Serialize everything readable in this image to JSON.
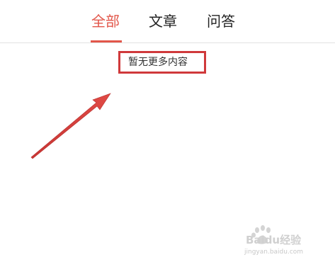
{
  "tabs": [
    {
      "label": "全部",
      "active": true
    },
    {
      "label": "文章",
      "active": false
    },
    {
      "label": "问答",
      "active": false
    }
  ],
  "empty_message": "暂无更多内容",
  "watermark": {
    "logo_text": "Baidu经验",
    "url_text": "jingyan.baidu.com"
  },
  "colors": {
    "accent": "#e2564a",
    "annotation_red": "#d0393b",
    "text": "#222222"
  }
}
